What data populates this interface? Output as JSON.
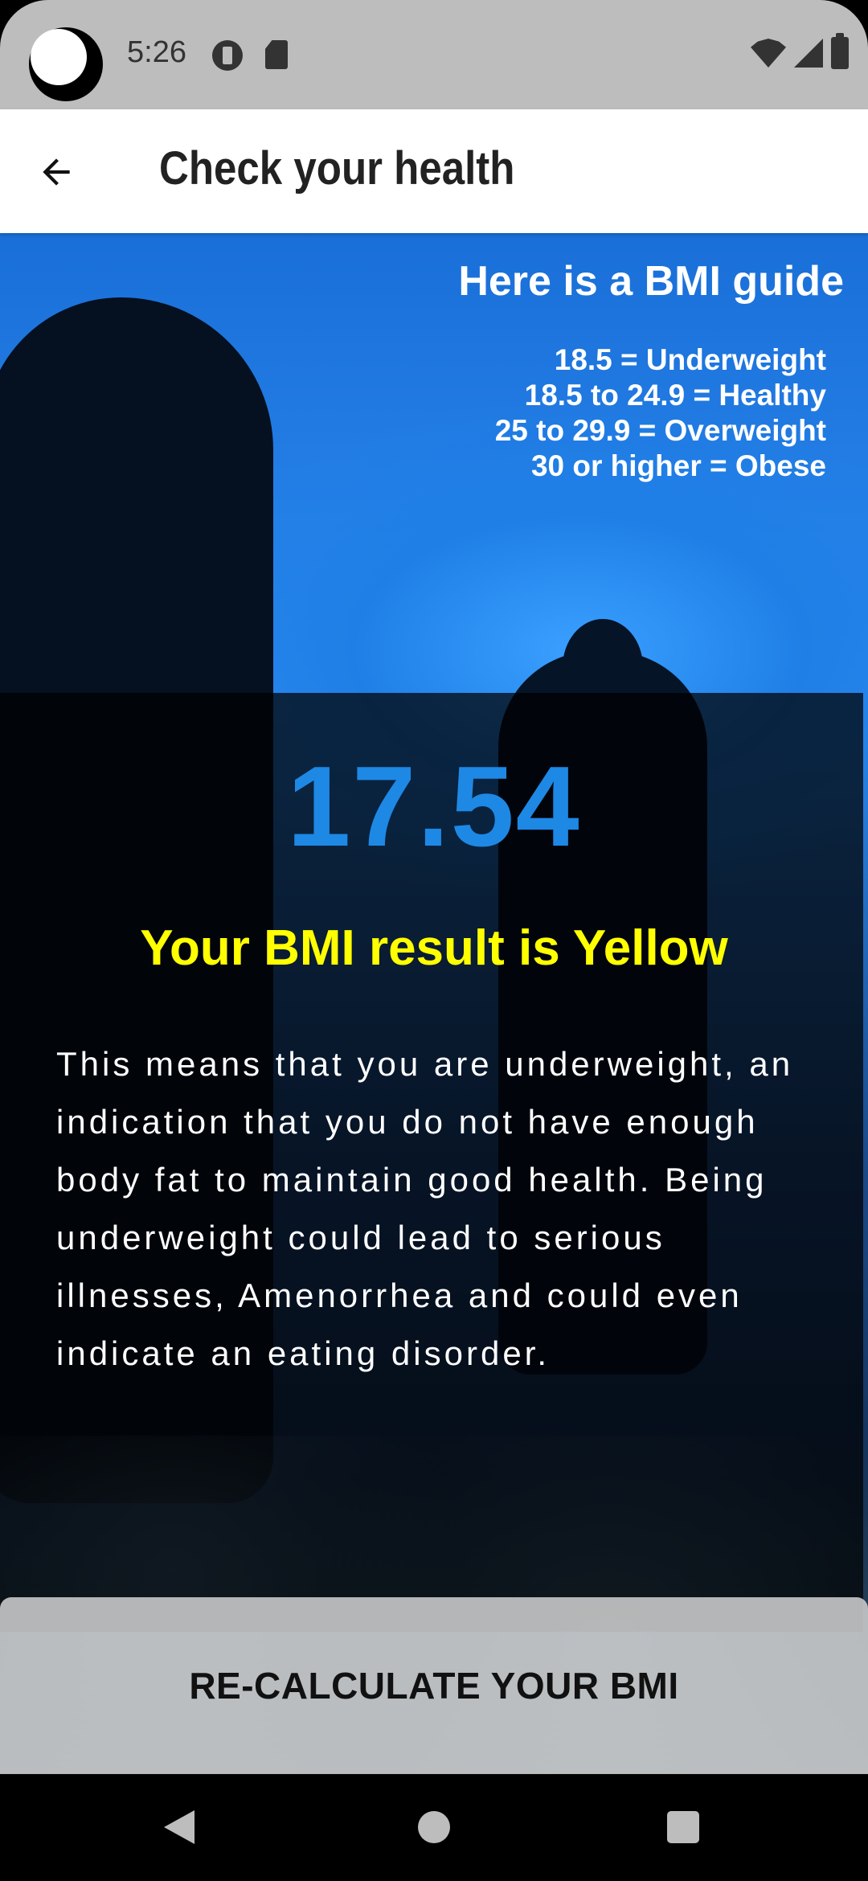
{
  "status_bar": {
    "time": "5:26"
  },
  "app_bar": {
    "title": "Check your health"
  },
  "bmi_guide": {
    "title": "Here is a BMI guide",
    "items": [
      "18.5 = Underweight",
      "18.5 to 24.9 = Healthy",
      "25 to 29.9 = Overweight",
      "30 or higher = Obese"
    ]
  },
  "result": {
    "bmi_value": "17.54",
    "label": "Your BMI result is Yellow",
    "description": "This means that you are underweight, an indication that you do not have enough body fat to maintain good health. Being underweight could lead to serious illnesses, Amenorrhea and could even indicate an eating disorder."
  },
  "actions": {
    "recalculate_label": "RE-CALCULATE YOUR BMI"
  },
  "colors": {
    "bmi_value": "#1e88e5",
    "result_label": "#ffff00",
    "app_bar": "#ffffff",
    "status_bar": "#bdbdbd"
  }
}
